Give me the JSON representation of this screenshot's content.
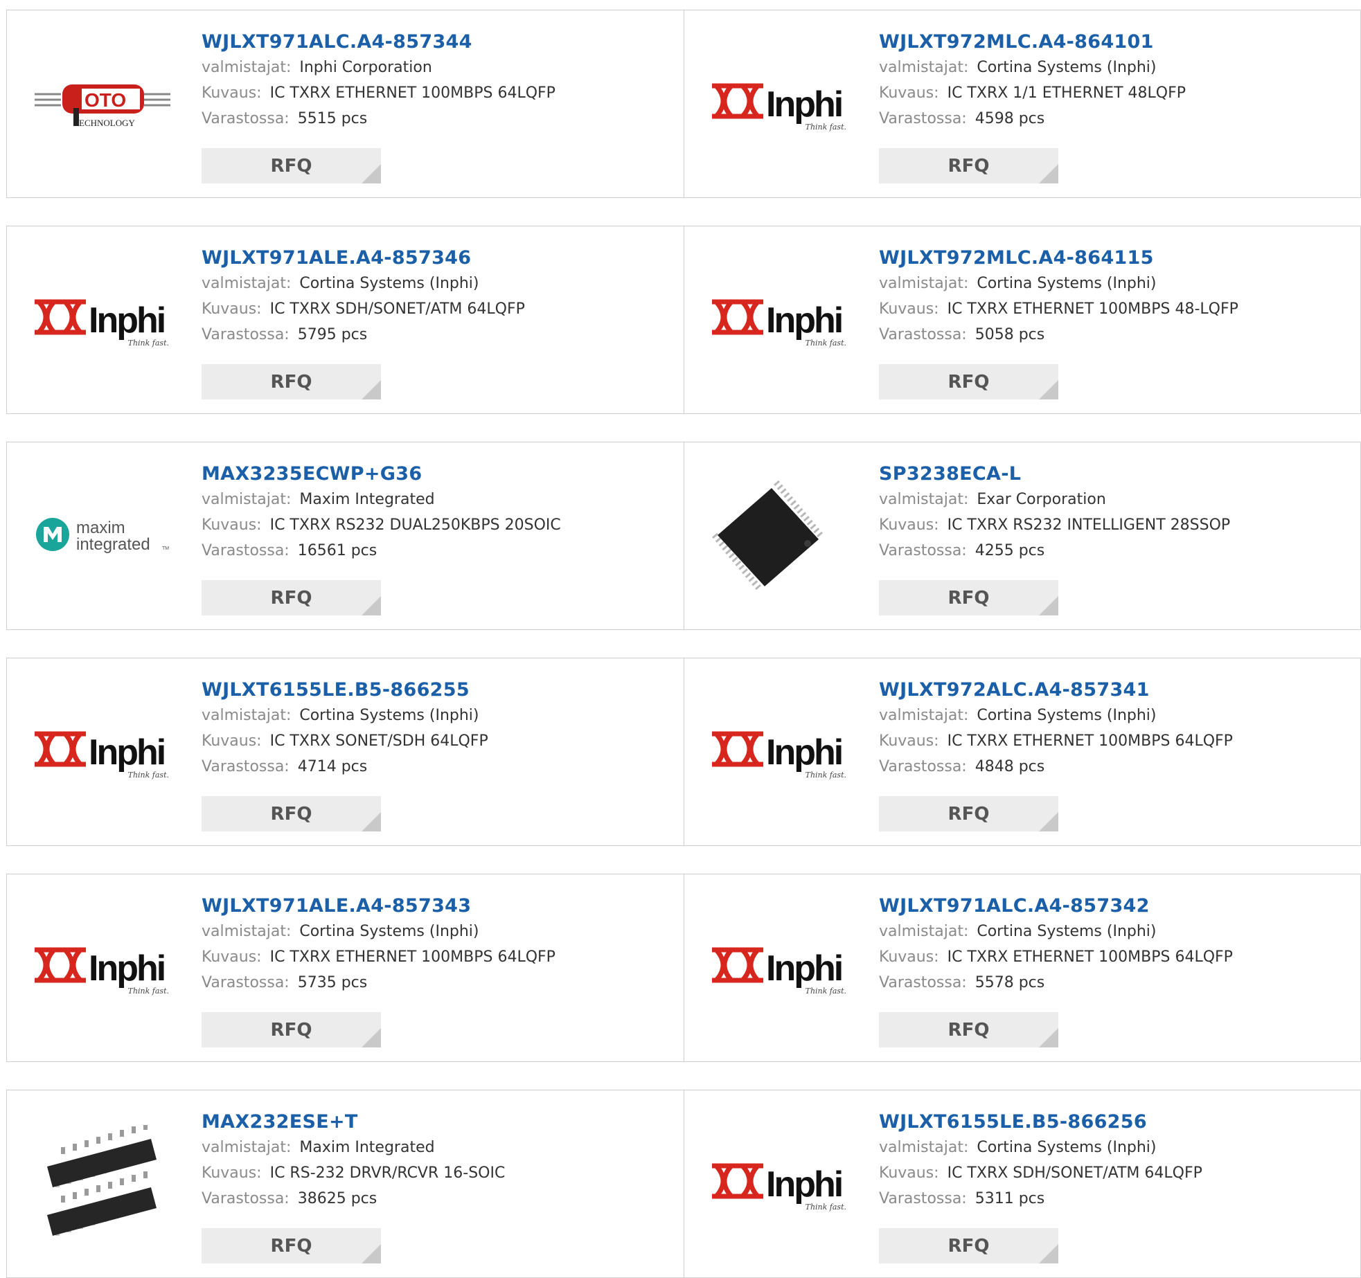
{
  "labels": {
    "manufacturer": "valmistajat:",
    "description": "Kuvaus:",
    "stock": "Varastossa:",
    "rfq": "RFQ",
    "inphi_word": "Inphi",
    "inphi_tag": "Think fast.",
    "coto_word": "OTO",
    "coto_tech": "ECHNOLOGY",
    "maxim_line1": "maxim",
    "maxim_line2": "integrated",
    "maxim_tm": "TM"
  },
  "colors": {
    "link": "#1a5fa8",
    "inphi_red": "#d7261e",
    "maxim_teal": "#1aa59a",
    "coto_red": "#c9201c"
  },
  "products": [
    {
      "part": "WJLXT971ALC.A4-857344",
      "manufacturer": "Inphi Corporation",
      "description": "IC TXRX ETHERNET 100MBPS 64LQFP",
      "stock": "5515 pcs",
      "logo": "coto-logo"
    },
    {
      "part": "WJLXT972MLC.A4-864101",
      "manufacturer": "Cortina Systems (Inphi)",
      "description": "IC TXRX 1/1 ETHERNET 48LQFP",
      "stock": "4598 pcs",
      "logo": "inphi-logo"
    },
    {
      "part": "WJLXT971ALE.A4-857346",
      "manufacturer": "Cortina Systems (Inphi)",
      "description": "IC TXRX SDH/SONET/ATM 64LQFP",
      "stock": "5795 pcs",
      "logo": "inphi-logo"
    },
    {
      "part": "WJLXT972MLC.A4-864115",
      "manufacturer": "Cortina Systems (Inphi)",
      "description": "IC TXRX ETHERNET 100MBPS 48-LQFP",
      "stock": "5058 pcs",
      "logo": "inphi-logo"
    },
    {
      "part": "MAX3235ECWP+G36",
      "manufacturer": "Maxim Integrated",
      "description": "IC TXRX RS232 DUAL250KBPS 20SOIC",
      "stock": "16561 pcs",
      "logo": "maxim-logo"
    },
    {
      "part": "SP3238ECA-L",
      "manufacturer": "Exar Corporation",
      "description": "IC TXRX RS232 INTELLIGENT 28SSOP",
      "stock": "4255 pcs",
      "logo": "ssop-chip-photo"
    },
    {
      "part": "WJLXT6155LE.B5-866255",
      "manufacturer": "Cortina Systems (Inphi)",
      "description": "IC TXRX SONET/SDH 64LQFP",
      "stock": "4714 pcs",
      "logo": "inphi-logo"
    },
    {
      "part": "WJLXT972ALC.A4-857341",
      "manufacturer": "Cortina Systems (Inphi)",
      "description": "IC TXRX ETHERNET 100MBPS 64LQFP",
      "stock": "4848 pcs",
      "logo": "inphi-logo"
    },
    {
      "part": "WJLXT971ALE.A4-857343",
      "manufacturer": "Cortina Systems (Inphi)",
      "description": "IC TXRX ETHERNET 100MBPS 64LQFP",
      "stock": "5735 pcs",
      "logo": "inphi-logo"
    },
    {
      "part": "WJLXT971ALC.A4-857342",
      "manufacturer": "Cortina Systems (Inphi)",
      "description": "IC TXRX ETHERNET 100MBPS 64LQFP",
      "stock": "5578 pcs",
      "logo": "inphi-logo"
    },
    {
      "part": "MAX232ESE+T",
      "manufacturer": "Maxim Integrated",
      "description": "IC RS-232 DRVR/RCVR 16-SOIC",
      "stock": "38625 pcs",
      "logo": "soic-chip-photo"
    },
    {
      "part": "WJLXT6155LE.B5-866256",
      "manufacturer": "Cortina Systems (Inphi)",
      "description": "IC TXRX SDH/SONET/ATM 64LQFP",
      "stock": "5311 pcs",
      "logo": "inphi-logo"
    }
  ]
}
